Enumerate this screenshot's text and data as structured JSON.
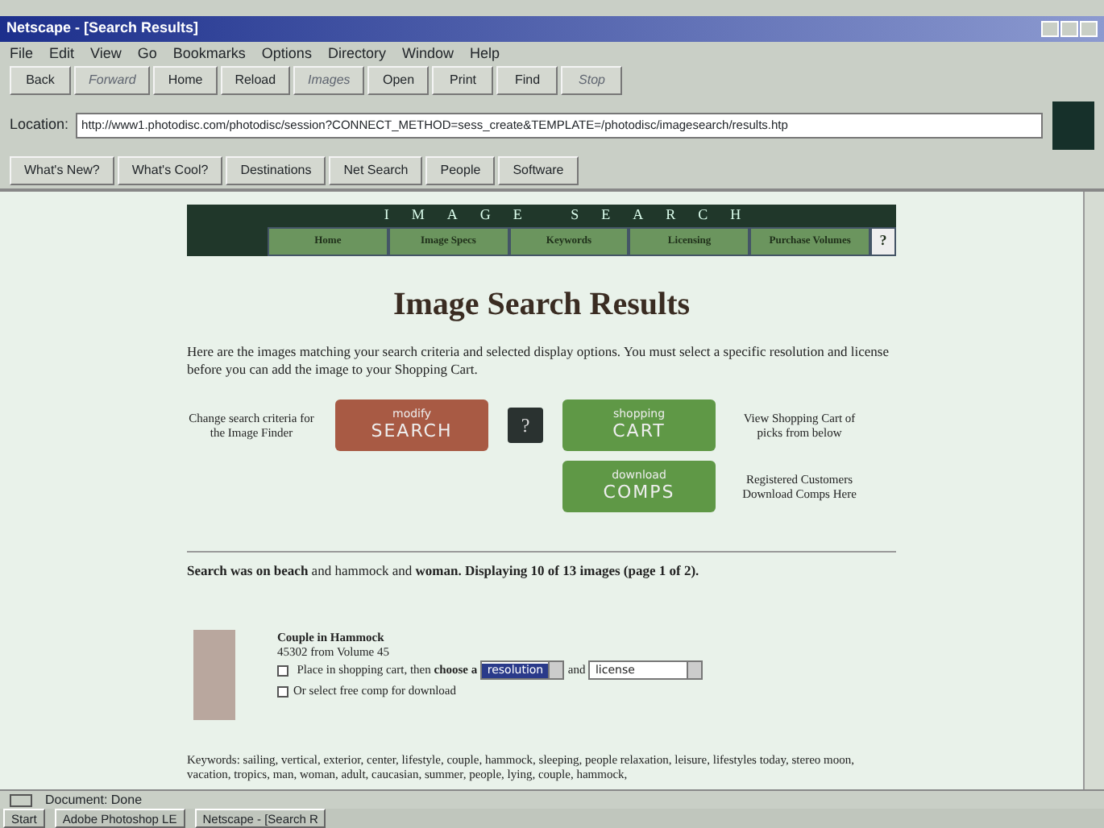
{
  "window": {
    "title": "Netscape - [Search Results]"
  },
  "menu": [
    "File",
    "Edit",
    "View",
    "Go",
    "Bookmarks",
    "Options",
    "Directory",
    "Window",
    "Help"
  ],
  "toolbar": [
    {
      "label": "Back",
      "disabled": false
    },
    {
      "label": "Forward",
      "disabled": true
    },
    {
      "label": "Home",
      "disabled": false
    },
    {
      "label": "Reload",
      "disabled": false
    },
    {
      "label": "Images",
      "disabled": true
    },
    {
      "label": "Open",
      "disabled": false
    },
    {
      "label": "Print",
      "disabled": false
    },
    {
      "label": "Find",
      "disabled": false
    },
    {
      "label": "Stop",
      "disabled": true
    }
  ],
  "location": {
    "label": "Location:",
    "value": "http://www1.photodisc.com/photodisc/session?CONNECT_METHOD=sess_create&TEMPLATE=/photodisc/imagesearch/results.htp"
  },
  "directory_buttons": [
    "What's New?",
    "What's Cool?",
    "Destinations",
    "Net Search",
    "People",
    "Software"
  ],
  "banner": {
    "title": "IMAGE SEARCH",
    "tabs": [
      "Home",
      "Image Specs",
      "Keywords",
      "Licensing",
      "Purchase Volumes",
      "?"
    ]
  },
  "heading": "Image Search Results",
  "intro": "Here are the images matching your search criteria and selected display options. You must select a specific resolution and license before you can add the image to your Shopping Cart.",
  "actions": {
    "search_note": "Change search criteria for the Image Finder",
    "modify": {
      "small": "modify",
      "big": "SEARCH"
    },
    "help": "?",
    "cart": {
      "small": "shopping",
      "big": "CART"
    },
    "cart_note": "View Shopping Cart of picks from below",
    "comps": {
      "small": "download",
      "big": "COMPS"
    },
    "comps_note": "Registered Customers Download Comps Here"
  },
  "summary": "**Search was on beach** and hammock and **woman. Displaying 10 of 13 images (page 1 of 2).**",
  "results": [
    {
      "title": "Couple in Hammock",
      "id": "45302 from Volume 45",
      "cart_label": "Place in shopping cart, then **choose a**",
      "cart_checked": false,
      "resolution": "resolution",
      "and": "and",
      "license": "license",
      "comp_label": "Or select free comp for download",
      "comp_checked": false,
      "keywords": "Keywords: sailing, vertical, exterior, center, lifestyle, couple, hammock, sleeping, people relaxation, leisure, lifestyles today, stereo moon, vacation, tropics, man, woman, adult, caucasian, summer, people, lying, couple, hammock,"
    }
  ],
  "status": "Document: Done",
  "taskbar": [
    "Start",
    "Adobe Photoshop LE",
    "Netscape - [Search R"
  ]
}
